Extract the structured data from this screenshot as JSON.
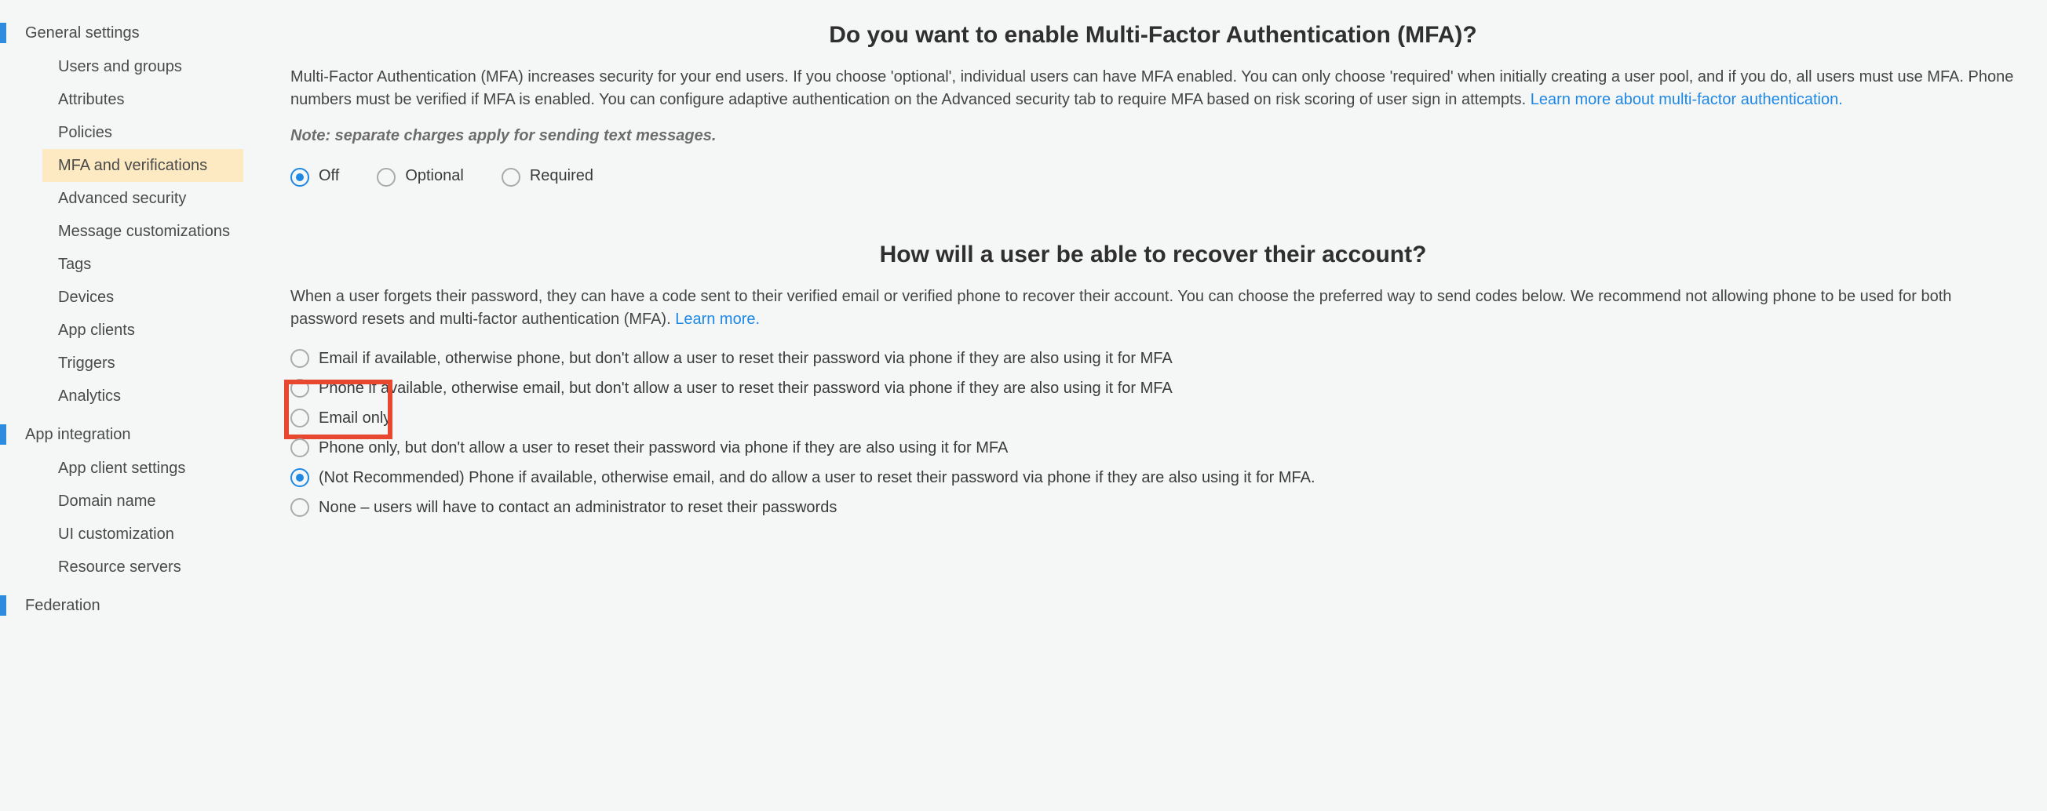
{
  "sidebar": {
    "sections": [
      {
        "heading": "General settings",
        "items": [
          {
            "label": "Users and groups",
            "active": false
          },
          {
            "label": "Attributes",
            "active": false
          },
          {
            "label": "Policies",
            "active": false
          },
          {
            "label": "MFA and verifications",
            "active": true
          },
          {
            "label": "Advanced security",
            "active": false
          },
          {
            "label": "Message customizations",
            "active": false
          },
          {
            "label": "Tags",
            "active": false
          },
          {
            "label": "Devices",
            "active": false
          },
          {
            "label": "App clients",
            "active": false
          },
          {
            "label": "Triggers",
            "active": false
          },
          {
            "label": "Analytics",
            "active": false
          }
        ]
      },
      {
        "heading": "App integration",
        "items": [
          {
            "label": "App client settings",
            "active": false
          },
          {
            "label": "Domain name",
            "active": false
          },
          {
            "label": "UI customization",
            "active": false
          },
          {
            "label": "Resource servers",
            "active": false
          }
        ]
      },
      {
        "heading": "Federation",
        "items": []
      }
    ]
  },
  "mfa": {
    "heading": "Do you want to enable Multi-Factor Authentication (MFA)?",
    "body": "Multi-Factor Authentication (MFA) increases security for your end users. If you choose 'optional', individual users can have MFA enabled. You can only choose 'required' when initially creating a user pool, and if you do, all users must use MFA. Phone numbers must be verified if MFA is enabled. You can configure adaptive authentication on the Advanced security tab to require MFA based on risk scoring of user sign in attempts. ",
    "learn": "Learn more about multi-factor authentication.",
    "note": "Note: separate charges apply for sending text messages.",
    "options": [
      {
        "label": "Off",
        "selected": true
      },
      {
        "label": "Optional",
        "selected": false
      },
      {
        "label": "Required",
        "selected": false
      }
    ]
  },
  "recovery": {
    "heading": "How will a user be able to recover their account?",
    "body": "When a user forgets their password, they can have a code sent to their verified email or verified phone to recover their account. You can choose the preferred way to send codes below. We recommend not allowing phone to be used for both password resets and multi-factor authentication (MFA). ",
    "learn": "Learn more.",
    "options": [
      {
        "label": "Email if available, otherwise phone, but don't allow a user to reset their password via phone if they are also using it for MFA",
        "selected": false,
        "highlighted": false
      },
      {
        "label": "Phone if available, otherwise email, but don't allow a user to reset their password via phone if they are also using it for MFA",
        "selected": false,
        "highlighted": false
      },
      {
        "label": "Email only",
        "selected": false,
        "highlighted": true
      },
      {
        "label": "Phone only, but don't allow a user to reset their password via phone if they are also using it for MFA",
        "selected": false,
        "highlighted": false
      },
      {
        "label": "(Not Recommended) Phone if available, otherwise email, and do allow a user to reset their password via phone if they are also using it for MFA.",
        "selected": true,
        "highlighted": false
      },
      {
        "label": "None – users will have to contact an administrator to reset their passwords",
        "selected": false,
        "highlighted": false
      }
    ]
  }
}
